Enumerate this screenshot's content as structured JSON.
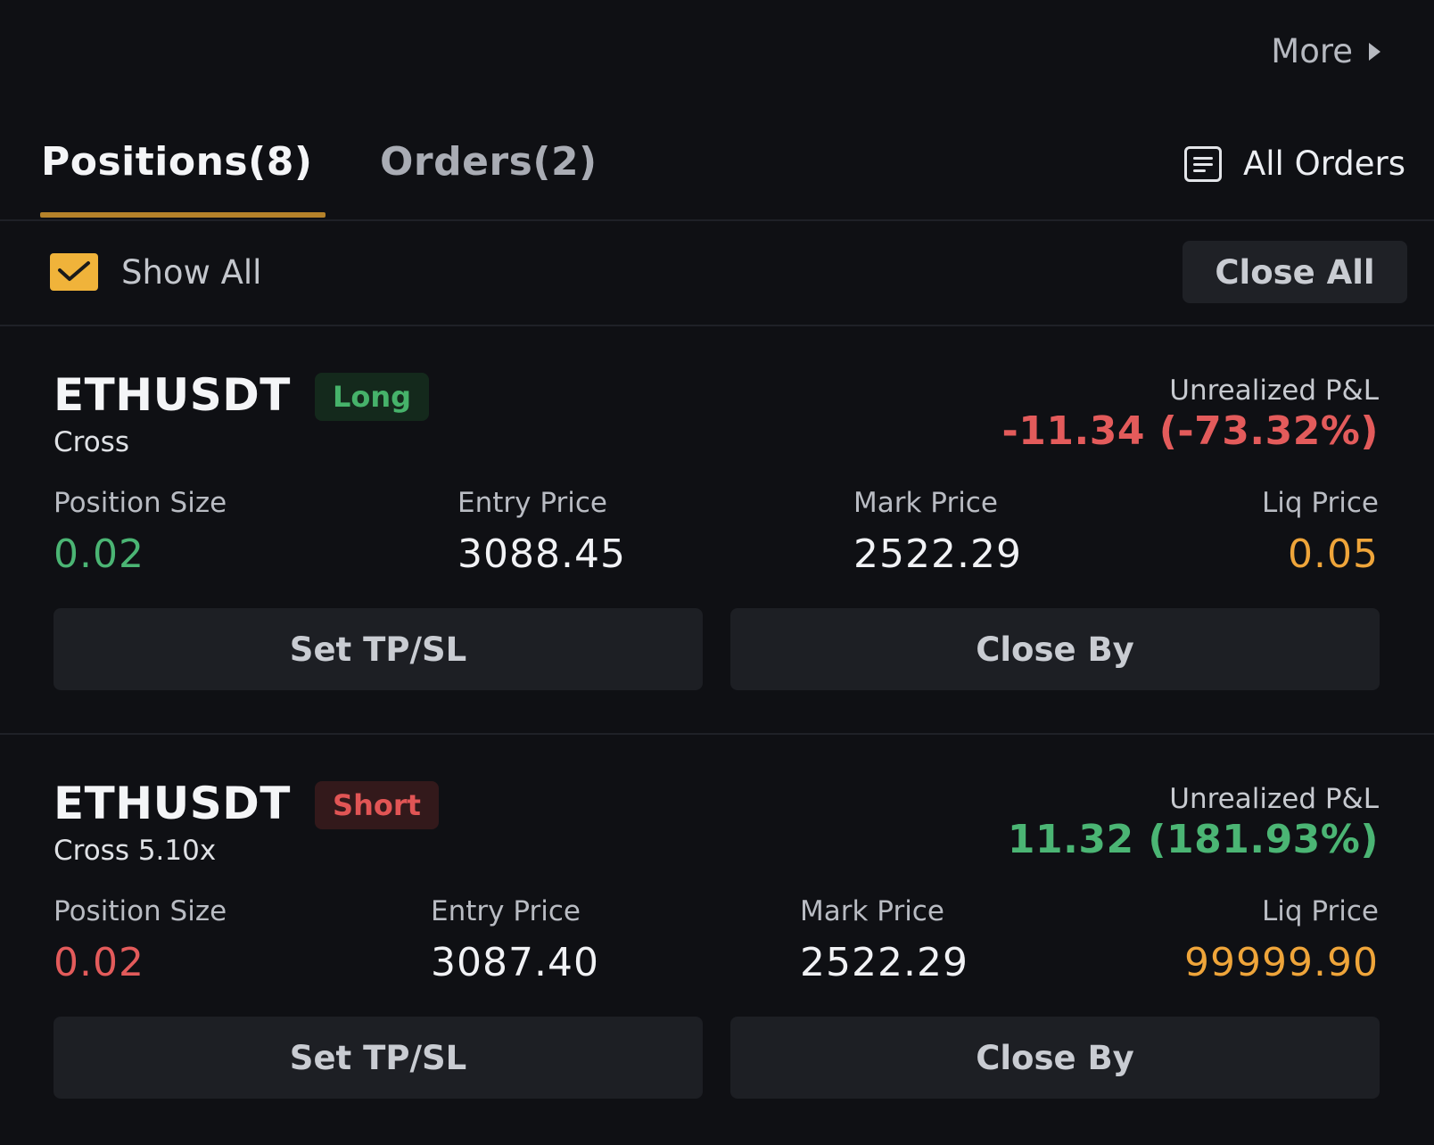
{
  "header": {
    "more_label": "More"
  },
  "tabs": [
    {
      "label": "Positions(8)",
      "active": true
    },
    {
      "label": "Orders(2)",
      "active": false
    }
  ],
  "all_orders_label": "All Orders",
  "toolbar": {
    "show_all_label": "Show All",
    "show_all_checked": true,
    "close_all_label": "Close All"
  },
  "positions": [
    {
      "symbol": "ETHUSDT",
      "side": "Long",
      "margin_mode": "Cross",
      "pnl_label": "Unrealized P&L",
      "pnl_value": "-11.34 (-73.32%)",
      "size_label": "Position Size",
      "size_value": "0.02",
      "entry_label": "Entry Price",
      "entry_value": "3088.45",
      "mark_label": "Mark Price",
      "mark_value": "2522.29",
      "liq_label": "Liq Price",
      "liq_value": "0.05",
      "tpsl_label": "Set TP/SL",
      "close_by_label": "Close By"
    },
    {
      "symbol": "ETHUSDT",
      "side": "Short",
      "margin_mode": "Cross 5.10x",
      "pnl_label": "Unrealized P&L",
      "pnl_value": "11.32 (181.93%)",
      "size_label": "Position Size",
      "size_value": "0.02",
      "entry_label": "Entry Price",
      "entry_value": "3087.40",
      "mark_label": "Mark Price",
      "mark_value": "2522.29",
      "liq_label": "Liq Price",
      "liq_value": "99999.90",
      "tpsl_label": "Set TP/SL",
      "close_by_label": "Close By"
    }
  ],
  "colors": {
    "background": "#0f1014",
    "accent": "#f0b33a",
    "tab_underline": "#b5822a",
    "positive": "#4bb574",
    "negative": "#e35b5b",
    "liq_price": "#efa53a"
  }
}
